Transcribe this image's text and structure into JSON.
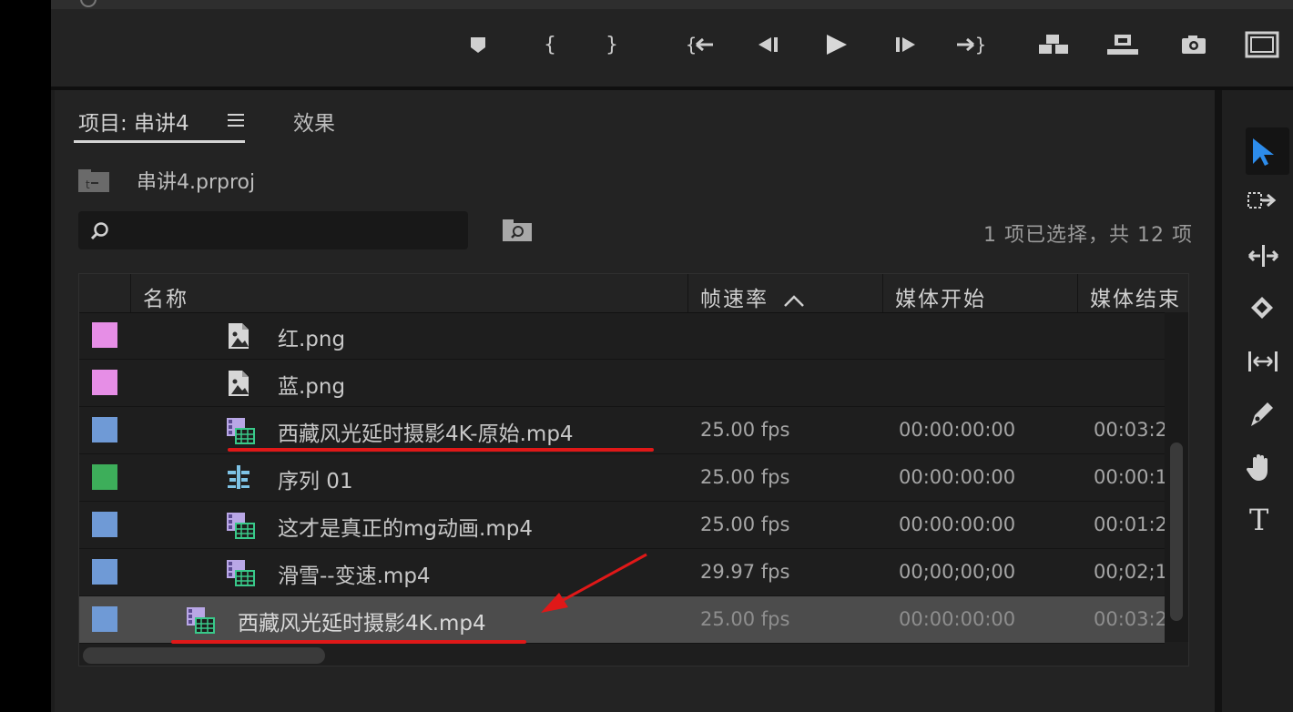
{
  "playback_controls": [
    {
      "name": "add-marker-icon"
    },
    {
      "name": "mark-in-icon"
    },
    {
      "name": "mark-out-icon"
    },
    {
      "name": "go-to-in-icon"
    },
    {
      "name": "step-back-icon"
    },
    {
      "name": "play-icon"
    },
    {
      "name": "step-forward-icon"
    },
    {
      "name": "go-to-out-icon"
    },
    {
      "name": "insert-icon"
    },
    {
      "name": "overwrite-icon"
    },
    {
      "name": "export-frame-icon"
    },
    {
      "name": "safe-margins-icon"
    }
  ],
  "tabs": {
    "project_label": "项目: 串讲4",
    "effects_label": "效果"
  },
  "project": {
    "file_name": "串讲4.prproj",
    "search_placeholder": "",
    "selection_status": "1 项已选择，共 12 项"
  },
  "table": {
    "columns": [
      "名称",
      "帧速率",
      "媒体开始",
      "媒体结束"
    ],
    "sort_indicator": "^",
    "rows": [
      {
        "label_color": "#e68ee6",
        "type": "image",
        "name": "红.png",
        "frame_rate": "",
        "media_start": "",
        "media_end": ""
      },
      {
        "label_color": "#e68ee6",
        "type": "image",
        "name": "蓝.png",
        "frame_rate": "",
        "media_start": "",
        "media_end": ""
      },
      {
        "label_color": "#6f9ad6",
        "type": "video",
        "name": "西藏风光延时摄影4K-原始.mp4",
        "frame_rate": "25.00 fps",
        "media_start": "00:00:00:00",
        "media_end": "00:03:2"
      },
      {
        "label_color": "#3dae5a",
        "type": "sequence",
        "name": "序列 01",
        "frame_rate": "25.00 fps",
        "media_start": "00:00:00:00",
        "media_end": "00:00:1"
      },
      {
        "label_color": "#6f9ad6",
        "type": "video",
        "name": "这才是真正的mg动画.mp4",
        "frame_rate": "25.00 fps",
        "media_start": "00:00:00:00",
        "media_end": "00:01:2"
      },
      {
        "label_color": "#6f9ad6",
        "type": "video",
        "name": "滑雪--变速.mp4",
        "frame_rate": "29.97 fps",
        "media_start": "00;00;00;00",
        "media_end": "00;02;1"
      },
      {
        "label_color": "#6f9ad6",
        "type": "video",
        "name": "西藏风光延时摄影4K.mp4",
        "frame_rate": "25.00 fps",
        "media_start": "00:00:00:00",
        "media_end": "00:03:2",
        "selected": true
      }
    ]
  },
  "tools": [
    {
      "name": "selection-tool-icon",
      "active": true
    },
    {
      "name": "track-select-tool-icon"
    },
    {
      "name": "ripple-edit-tool-icon"
    },
    {
      "name": "razor-tool-icon"
    },
    {
      "name": "slip-tool-icon"
    },
    {
      "name": "pen-tool-icon"
    },
    {
      "name": "hand-tool-icon"
    },
    {
      "name": "type-tool-icon",
      "glyph": "T"
    }
  ],
  "colors": {
    "accent_blue": "#2d8ceb",
    "annotation_red": "#e01818"
  }
}
